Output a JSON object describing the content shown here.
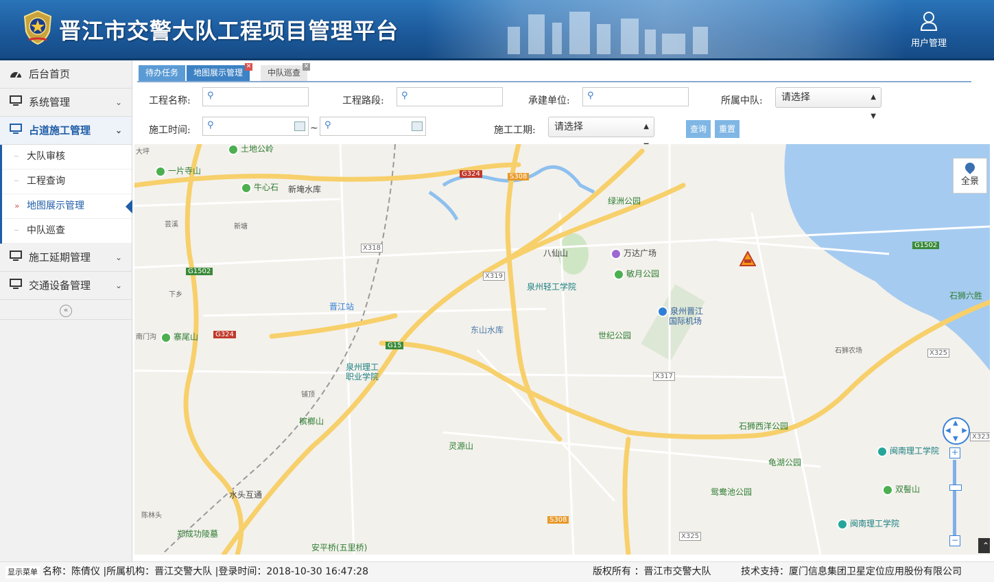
{
  "header": {
    "title": "晋江市交警大队工程项目管理平台",
    "user_label": "用户管理"
  },
  "sidebar": {
    "items": [
      {
        "label": "后台首页",
        "icon": "dashboard-icon"
      },
      {
        "label": "系统管理",
        "icon": "monitor-icon"
      },
      {
        "label": "占道施工管理",
        "icon": "monitor-icon"
      },
      {
        "label": "施工延期管理",
        "icon": "monitor-icon"
      },
      {
        "label": "交通设备管理",
        "icon": "monitor-icon"
      }
    ],
    "sub_items": [
      "大队审核",
      "工程查询",
      "地图展示管理",
      "中队巡查"
    ],
    "collapse": "«"
  },
  "tabs": [
    "待办任务",
    "地图展示管理",
    "中队巡查"
  ],
  "form": {
    "project_name_label": "工程名称:",
    "project_road_label": "工程路段:",
    "contractor_label": "承建单位:",
    "squad_label": "所属中队:",
    "squad_value": "请选择",
    "time_label": "施工时间:",
    "range_sep": "~",
    "period_label": "施工工期:",
    "period_value": "请选择",
    "query_btn": "查询",
    "reset_btn": "重置"
  },
  "map": {
    "fullview": "全景",
    "labels": [
      "大坪",
      "土地公岭",
      "一片寺山",
      "牛心石",
      "新埯水库",
      "芸溪",
      "新塘",
      "X318",
      "G1502",
      "下乡",
      "南门沟",
      "寨尾山",
      "G324",
      "晋江站",
      "八仙山",
      "万达广场",
      "敏月公园",
      "X319",
      "泉州轻工学院",
      "绿洲公园",
      "G324",
      "S308",
      "东山水库",
      "世纪公园",
      "泉州晋江",
      "国际机场",
      "G15",
      "泉州理工",
      "职业学院",
      "铺顶",
      "槟榔山",
      "灵源山",
      "水头互通",
      "陈林头",
      "郑成功陵墓",
      "安平桥(五里桥)",
      "石狮农场",
      "石狮西洋公园",
      "龟湖公园",
      "鸳鸯池公园",
      "闽南理工学院",
      "双髻山",
      "闽南理工学院",
      "石狮六胜",
      "G1502",
      "X325",
      "X317",
      "X323",
      "X325",
      "S308"
    ]
  },
  "status": {
    "menu_btn": "显示菜单",
    "user_info": "名称：陈倩仪 |所属机构：晋江交警大队 |登录时间：2018-10-30 16:47:28",
    "copyright": "版权所有 ：晋江市交警大队",
    "support": "技术支持：厦门信息集团卫星定位应用股份有限公司"
  }
}
